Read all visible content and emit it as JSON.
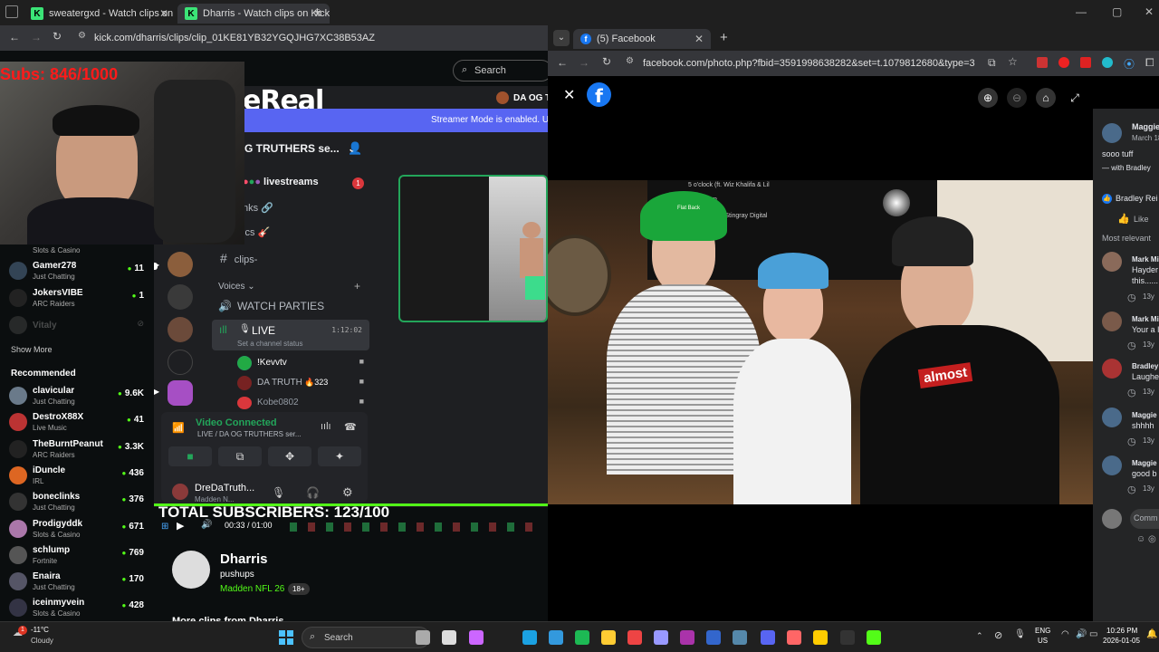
{
  "left_browser": {
    "tabs": [
      {
        "title": "sweatergxd - Watch clips on Kic"
      },
      {
        "title": "Dharris - Watch clips on Kick"
      }
    ],
    "url": "kick.com/dharris/clips/clip_01KE81YB32YGQJHG7XC38B53AZ",
    "search_placeholder": "Search"
  },
  "overlay": {
    "subs_counter": "Subs: 846/1000",
    "total_subscribers": "TOTAL SUBSCRIBERS: 123/100",
    "logo_text": "eReal_"
  },
  "discord": {
    "top_user": "DA OG T",
    "banner": "Streamer Mode is enabled. Us",
    "server_name": "G TRUTHERS se...",
    "channels": {
      "livestreams": "livestreams",
      "livestreams_badge": "1",
      "links": "nks 🔗",
      "music": "ics 🎸",
      "clips": "clips-",
      "voices": "Voices",
      "watch_parties": "WATCH PARTIES",
      "live": "LIVE",
      "live_time": "1:12:02",
      "status": "Set a channel status"
    },
    "voice_users": [
      {
        "name": "!Kevvtv"
      },
      {
        "name": "DA TRUTH",
        "badge": "323"
      },
      {
        "name": "Kobe0802"
      }
    ],
    "voice_connected": "Video Connected",
    "voice_channel": "LIVE / DA OG TRUTHERS ser...",
    "self_name": "DreDaTruth...",
    "self_status": "Madden N..."
  },
  "player": {
    "time": "00:33 / 01:00"
  },
  "clip": {
    "channel": "Dharris",
    "title": "pushups",
    "category": "Madden NFL 26",
    "rating": "18+",
    "more_clips": "More clips from Dharris"
  },
  "sidebar": {
    "top_partial": "Slots & Casino",
    "channels": [
      {
        "name": "Gamer278",
        "sub": "Just Chatting",
        "count": "11"
      },
      {
        "name": "JokersVIBE",
        "sub": "ARC Raiders",
        "count": "1"
      },
      {
        "name": "Vitaly",
        "sub": "",
        "count": ""
      }
    ],
    "show_more": "Show More",
    "recommended_title": "Recommended",
    "recommended": [
      {
        "name": "clavicular",
        "sub": "Just Chatting",
        "count": "9.6K"
      },
      {
        "name": "DestroX88X",
        "sub": "Live Music",
        "count": "41"
      },
      {
        "name": "TheBurntPeanut",
        "sub": "ARC Raiders",
        "count": "3.3K"
      },
      {
        "name": "iDuncle",
        "sub": "IRL",
        "count": "436"
      },
      {
        "name": "boneclinks",
        "sub": "Just Chatting",
        "count": "376"
      },
      {
        "name": "Prodigyddk",
        "sub": "Slots & Casino",
        "count": "671"
      },
      {
        "name": "schlump",
        "sub": "Fortnite",
        "count": "769"
      },
      {
        "name": "Enaira",
        "sub": "Just Chatting",
        "count": "170"
      },
      {
        "name": "iceinmyvein",
        "sub": "Slots & Casino",
        "count": "428"
      }
    ]
  },
  "facebook": {
    "tab_title": "(5) Facebook",
    "url": "facebook.com/photo.php?fbid=3591998638282&set=t.1079812680&type=3",
    "photo_tv_text_1": "5 o'clock (ft. Wiz Khalifa & Lil",
    "photo_tv_text_2": "R",
    "photo_tv_text_3": "by Stingray Digital",
    "shirt_text": "almost",
    "hat_text": "Flat Back",
    "poster": {
      "name": "Maggie",
      "date": "March 18"
    },
    "caption": "sooo tuff",
    "with": "— with Bradley",
    "reaction": "Bradley Rei",
    "like": "Like",
    "most_relevant": "Most relevant",
    "comments": [
      {
        "name": "Mark Mi",
        "l1": "Hayder",
        "l2": "this......",
        "time": "13y"
      },
      {
        "name": "Mark Mi",
        "l1": "Your a l",
        "l2": "",
        "time": "13y"
      },
      {
        "name": "Bradley",
        "l1": "Laughe",
        "l2": "",
        "time": "13y"
      },
      {
        "name": "Maggie",
        "l1": "shhhh",
        "l2": "",
        "time": "13y"
      },
      {
        "name": "Maggie",
        "l1": "good b",
        "l2": "",
        "time": "13y"
      }
    ],
    "comment_placeholder": "Comm"
  },
  "taskbar": {
    "weather_temp": "-11°C",
    "weather_desc": "Cloudy",
    "weather_badge": "1",
    "search": "Search",
    "lang1": "ENG",
    "lang2": "US",
    "time": "10:26 PM",
    "date": "2026-01-05"
  }
}
